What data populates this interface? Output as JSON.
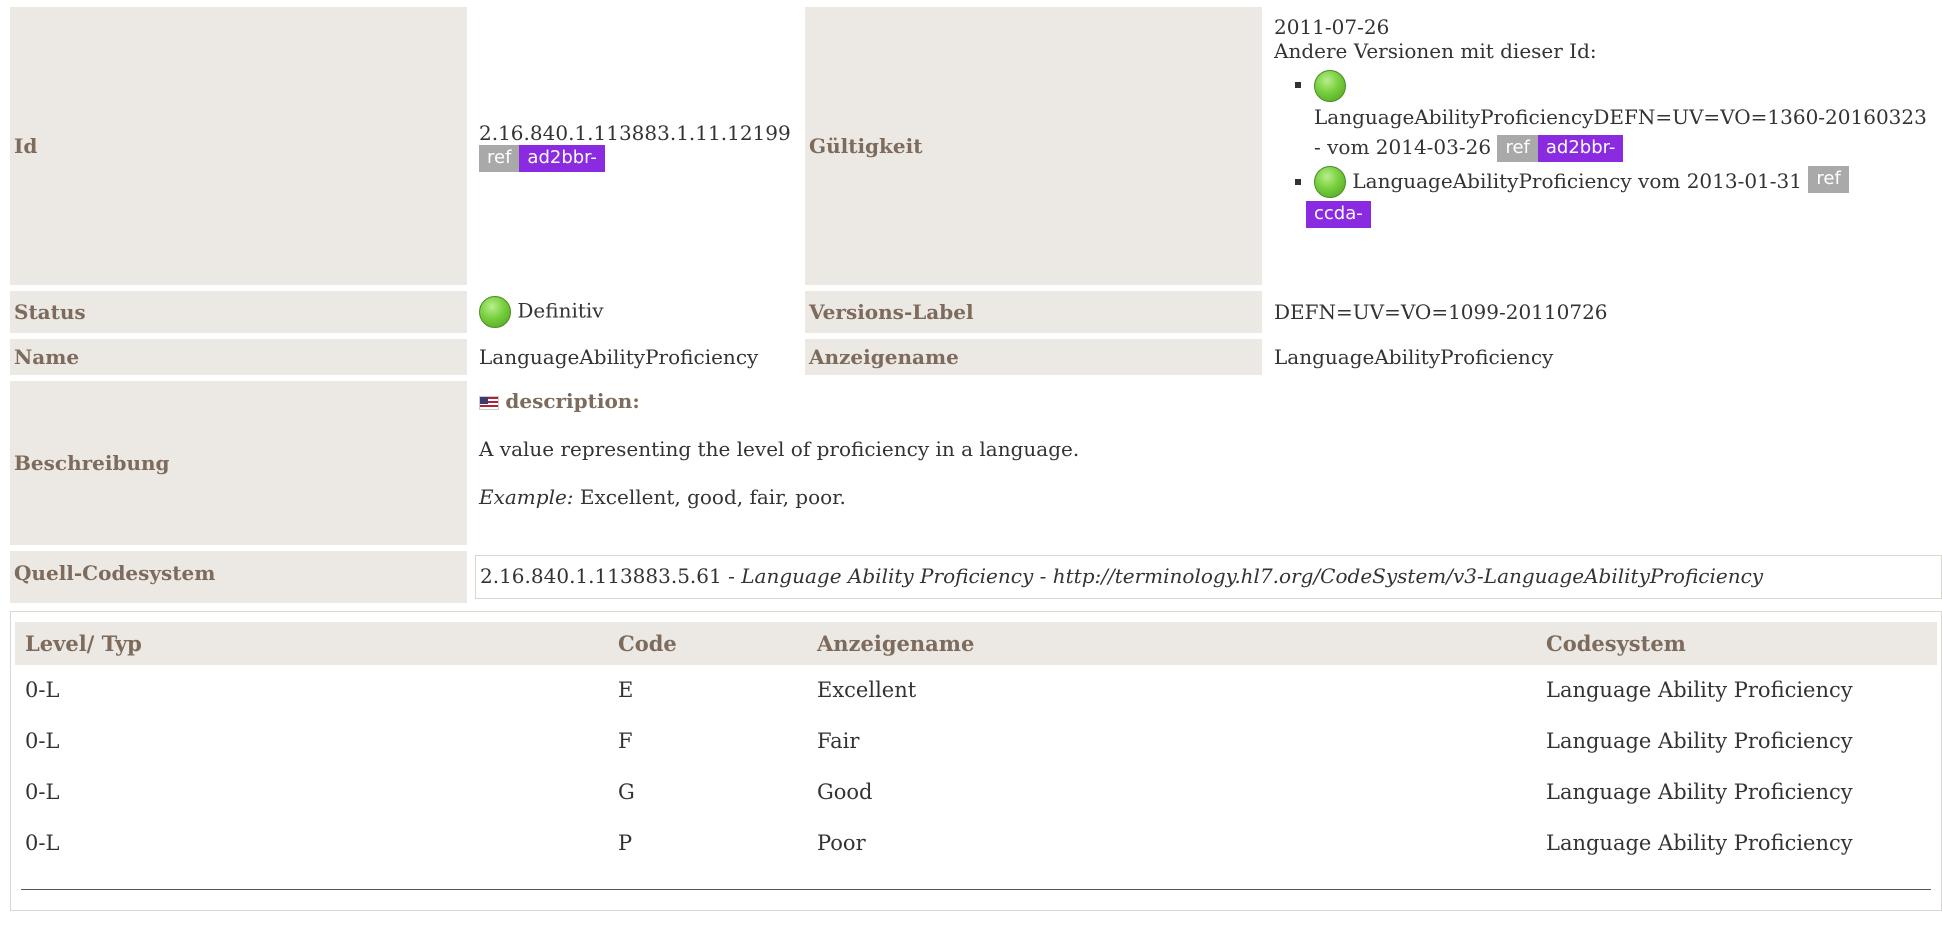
{
  "meta": {
    "id_label": "Id",
    "id_value": "2.16.840.1.113883.1.11.12199",
    "id_ref": "ref",
    "id_prefix": "ad2bbr-",
    "validity_label": "Gültigkeit",
    "validity_date": "2011-07-26",
    "other_versions_label": "Andere Versionen mit dieser Id:",
    "other_versions": [
      {
        "name": "LanguageAbilityProficiencyDEFN=UV=VO=1360-20160323",
        "date_text": "- vom 2014-03-26",
        "ref": "ref",
        "prefix": "ad2bbr-"
      },
      {
        "name": "LanguageAbilityProficiency vom 2013-01-31",
        "ref": "ref",
        "prefix": "ccda-"
      }
    ],
    "status_label": "Status",
    "status_value": "Definitiv",
    "version_label_label": "Versions-Label",
    "version_label_value": "DEFN=UV=VO=1099-20110726",
    "name_label": "Name",
    "name_value": "LanguageAbilityProficiency",
    "display_name_label": "Anzeigename",
    "display_name_value": "LanguageAbilityProficiency",
    "description_label": "Beschreibung",
    "description_heading": "description:",
    "description_text": "A value representing the level of proficiency in a language.",
    "example_label": "Example:",
    "example_text": " Excellent, good, fair, poor.",
    "source_label": "Quell-Codesystem",
    "source_oid": "2.16.840.1.113883.5.61",
    "source_name": "Language Ability Proficiency",
    "source_uri": "http://terminology.hl7.org/CodeSystem/v3-LanguageAbilityProficiency"
  },
  "codes": {
    "headers": [
      "Level/ Typ",
      "Code",
      "Anzeigename",
      "Codesystem"
    ],
    "rows": [
      {
        "level": "0-L",
        "code": "E",
        "display": "Excellent",
        "system": "Language Ability Proficiency"
      },
      {
        "level": "0-L",
        "code": "F",
        "display": "Fair",
        "system": "Language Ability Proficiency"
      },
      {
        "level": "0-L",
        "code": "G",
        "display": "Good",
        "system": "Language Ability Proficiency"
      },
      {
        "level": "0-L",
        "code": "P",
        "display": "Poor",
        "system": "Language Ability Proficiency"
      }
    ]
  },
  "colors": {
    "label_bg": "#ece8e3",
    "label_text": "#7d6c5d",
    "ref_badge": "#a9a9a9",
    "prefix_badge": "#8a2be2",
    "status_ball": "#77cf3d"
  }
}
